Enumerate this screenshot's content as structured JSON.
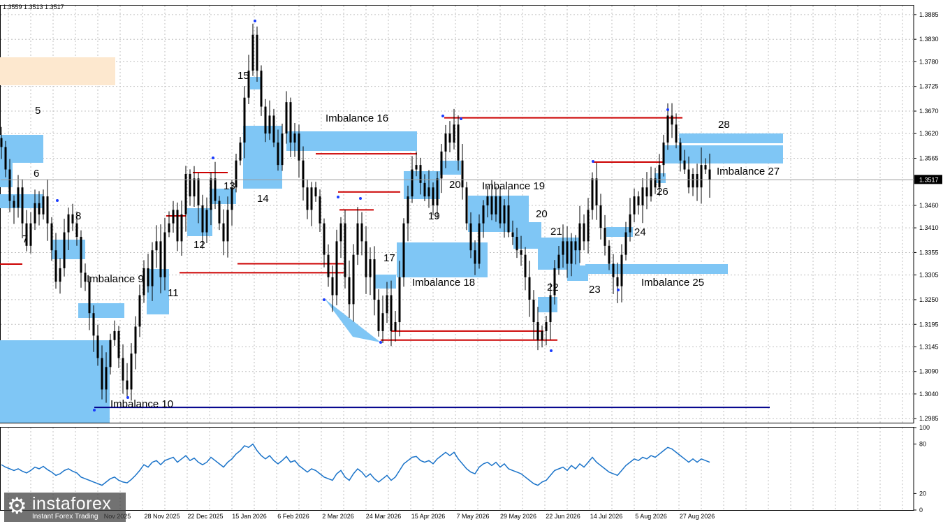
{
  "header": {
    "ohlc": "1.3559 1.3513 1.3517"
  },
  "logo": {
    "name": "instaforex",
    "tagline": "Instant Forex Trading",
    "icon": "gear-icon"
  },
  "colors": {
    "zone": "#7fc6f5",
    "zone_light": "#fde8cf",
    "level_red": "#cc0000",
    "level_blue": "#00008b",
    "candle": "#000000",
    "osc": "#1a73c9",
    "grid": "#c0c0c0",
    "current_bg": "#000000"
  },
  "chart_data": {
    "type": "line",
    "price_panel": {
      "ylim": [
        1.2976,
        1.3905
      ],
      "y_ticks": [
        "1.3885",
        "1.3830",
        "1.3780",
        "1.3725",
        "1.3670",
        "1.3620",
        "1.3565",
        "1.3460",
        "1.3410",
        "1.3355",
        "1.3305",
        "1.3250",
        "1.3195",
        "1.3145",
        "1.3090",
        "1.3040",
        "1.2985"
      ],
      "current_price": "1.3517",
      "x_ticks": [
        "28 Nov 2025",
        "22 Dec 2025",
        "15 Jan 2026",
        "6 Feb 2026",
        "2 Mar 2026",
        "24 Mar 2026",
        "15 Apr 2026",
        "7 May 2026",
        "29 May 2026",
        "22 Jun 2026",
        "14 Jul 2026",
        "5 Aug 2026",
        "27 Aug 2026"
      ],
      "x_partial_tick": "Nov 2025",
      "close_series": [
        1.359,
        1.354,
        1.347,
        1.3455,
        1.35,
        1.342,
        1.337,
        1.342,
        1.3465,
        1.344,
        1.348,
        1.342,
        1.336,
        1.329,
        1.332,
        1.34,
        1.344,
        1.342,
        1.339,
        1.331,
        1.329,
        1.322,
        1.317,
        1.312,
        1.305,
        1.31,
        1.316,
        1.318,
        1.312,
        1.307,
        1.305,
        1.313,
        1.319,
        1.326,
        1.332,
        1.328,
        1.336,
        1.338,
        1.33,
        1.34,
        1.342,
        1.345,
        1.338,
        1.344,
        1.353,
        1.348,
        1.352,
        1.346,
        1.34,
        1.345,
        1.352,
        1.347,
        1.342,
        1.338,
        1.345,
        1.35,
        1.356,
        1.36,
        1.37,
        1.376,
        1.384,
        1.376,
        1.368,
        1.362,
        1.366,
        1.36,
        1.355,
        1.362,
        1.369,
        1.36,
        1.362,
        1.356,
        1.35,
        1.345,
        1.35,
        1.348,
        1.342,
        1.335,
        1.33,
        1.326,
        1.338,
        1.342,
        1.33,
        1.324,
        1.335,
        1.342,
        1.338,
        1.33,
        1.334,
        1.325,
        1.318,
        1.322,
        1.326,
        1.318,
        1.32,
        1.33,
        1.342,
        1.348,
        1.354,
        1.355,
        1.351,
        1.348,
        1.35,
        1.346,
        1.352,
        1.358,
        1.362,
        1.36,
        1.364,
        1.356,
        1.35,
        1.342,
        1.336,
        1.333,
        1.342,
        1.346,
        1.348,
        1.344,
        1.348,
        1.342,
        1.346,
        1.34,
        1.339,
        1.336,
        1.335,
        1.33,
        1.325,
        1.32,
        1.316,
        1.318,
        1.32,
        1.326,
        1.332,
        1.335,
        1.338,
        1.333,
        1.338,
        1.336,
        1.342,
        1.338,
        1.345,
        1.352,
        1.346,
        1.341,
        1.337,
        1.333,
        1.33,
        1.328,
        1.335,
        1.34,
        1.344,
        1.348,
        1.346,
        1.35,
        1.348,
        1.352,
        1.35,
        1.355,
        1.36,
        1.366,
        1.364,
        1.36,
        1.356,
        1.354,
        1.35,
        1.353,
        1.35,
        1.355,
        1.354,
        1.3517
      ]
    },
    "zones": [
      {
        "label": "5",
        "style": "zone"
      },
      {
        "label": "6",
        "style": "zone"
      },
      {
        "label": "7",
        "style": "zone"
      },
      {
        "label": "8",
        "style": "zone"
      },
      {
        "label": "Imbalance 9",
        "style": "zone"
      },
      {
        "label": "Imbalance 10",
        "style": "zone"
      },
      {
        "label": "11",
        "style": "zone"
      },
      {
        "label": "12",
        "style": "zone"
      },
      {
        "label": "13",
        "style": "zone"
      },
      {
        "label": "14",
        "style": "zone"
      },
      {
        "label": "15",
        "style": "zone"
      },
      {
        "label": "Imbalance 16",
        "style": "zone"
      },
      {
        "label": "17",
        "style": "zone"
      },
      {
        "label": "Imbalance 18",
        "style": "zone"
      },
      {
        "label": "19",
        "style": "zone"
      },
      {
        "label": "20",
        "style": "zone"
      },
      {
        "label": "Imbalance 19",
        "style": "zone"
      },
      {
        "label": "20",
        "style": "zone"
      },
      {
        "label": "21",
        "style": "zone"
      },
      {
        "label": "22",
        "style": "zone"
      },
      {
        "label": "23",
        "style": "zone"
      },
      {
        "label": "24",
        "style": "zone"
      },
      {
        "label": "Imbalance 25",
        "style": "zone"
      },
      {
        "label": "26",
        "style": "zone"
      },
      {
        "label": "Imbalance 27",
        "style": "zone"
      },
      {
        "label": "28",
        "style": "zone"
      }
    ],
    "red_levels": [
      1.3655,
      1.3575,
      1.349,
      1.345,
      1.333,
      1.331,
      1.318,
      1.316
    ],
    "blue_level": 1.301,
    "oscillator": {
      "ylim": [
        0,
        100
      ],
      "y_ticks": [
        "100",
        "80",
        "20",
        "0"
      ],
      "values": [
        55,
        52,
        50,
        48,
        50,
        47,
        45,
        48,
        52,
        50,
        53,
        49,
        46,
        42,
        44,
        48,
        50,
        47,
        45,
        40,
        38,
        36,
        34,
        32,
        30,
        34,
        38,
        40,
        36,
        34,
        33,
        37,
        42,
        48,
        55,
        52,
        58,
        60,
        55,
        60,
        62,
        64,
        58,
        62,
        66,
        60,
        63,
        58,
        55,
        58,
        64,
        60,
        56,
        52,
        58,
        62,
        68,
        72,
        78,
        76,
        80,
        72,
        66,
        62,
        66,
        60,
        56,
        60,
        65,
        58,
        60,
        54,
        50,
        46,
        50,
        48,
        44,
        40,
        38,
        36,
        44,
        48,
        40,
        36,
        44,
        50,
        46,
        40,
        44,
        38,
        34,
        38,
        42,
        36,
        40,
        48,
        56,
        60,
        64,
        65,
        60,
        58,
        60,
        56,
        62,
        66,
        70,
        66,
        70,
        62,
        56,
        50,
        46,
        44,
        52,
        56,
        58,
        54,
        58,
        52,
        56,
        50,
        48,
        46,
        44,
        40,
        36,
        32,
        30,
        34,
        36,
        42,
        48,
        50,
        52,
        48,
        54,
        50,
        56,
        52,
        58,
        64,
        58,
        54,
        50,
        46,
        44,
        42,
        48,
        54,
        58,
        62,
        60,
        64,
        62,
        66,
        64,
        68,
        72,
        76,
        74,
        70,
        66,
        62,
        58,
        62,
        58,
        62,
        60,
        58
      ]
    }
  }
}
